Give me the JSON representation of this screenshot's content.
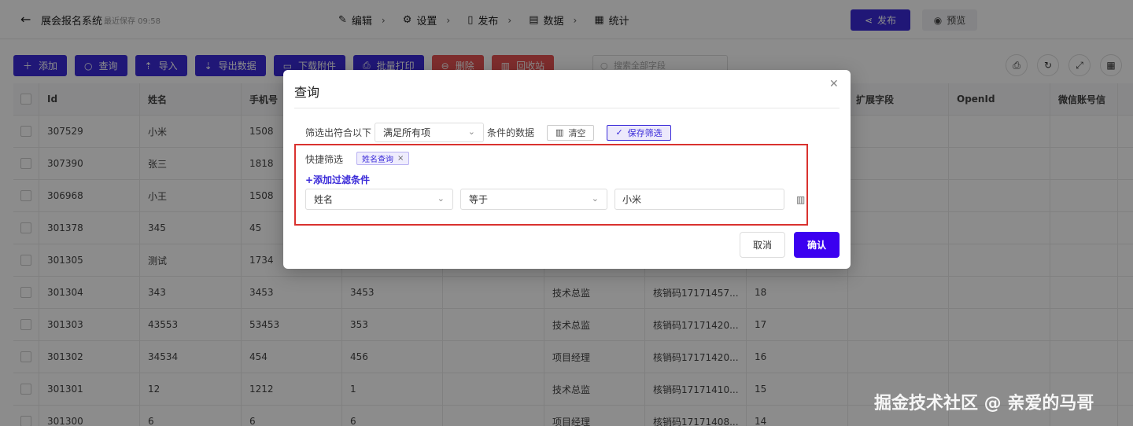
{
  "topbar": {
    "back_icon": "arrow-left-icon",
    "app_title": "展会报名系统",
    "save_status": "最近保存 09:58",
    "nav": [
      {
        "label": "编辑",
        "icon": "edit-icon"
      },
      {
        "label": "设置",
        "icon": "gear-icon"
      },
      {
        "label": "发布",
        "icon": "publish-doc-icon"
      },
      {
        "label": "数据",
        "icon": "data-doc-icon"
      },
      {
        "label": "统计",
        "icon": "stats-icon"
      }
    ],
    "publish_label": "发布",
    "preview_label": "预览"
  },
  "toolbar": {
    "buttons": [
      {
        "label": "添加",
        "icon": "plus-icon"
      },
      {
        "label": "查询",
        "icon": "search-icon"
      },
      {
        "label": "导入",
        "icon": "upload-icon"
      },
      {
        "label": "导出数据",
        "icon": "download-icon"
      },
      {
        "label": "下载附件",
        "icon": "folder-icon"
      },
      {
        "label": "批量打印",
        "icon": "print-icon"
      },
      {
        "label": "删除",
        "icon": "minus-circle-icon"
      },
      {
        "label": "回收站",
        "icon": "trash-icon"
      }
    ],
    "search_placeholder": "搜索全部字段",
    "round_tools": [
      "print-icon",
      "refresh-icon",
      "fullscreen-icon",
      "layout-icon"
    ]
  },
  "table": {
    "columns": [
      "",
      "Id",
      "姓名",
      "手机号",
      "",
      "",
      "",
      "",
      "",
      "扩展字段",
      "OpenId",
      "微信账号信"
    ],
    "rows": [
      [
        "307529",
        "小米",
        "1508",
        "",
        "",
        "",
        "",
        ""
      ],
      [
        "307390",
        "张三",
        "1818",
        "",
        "",
        "",
        "",
        ""
      ],
      [
        "306968",
        "小王",
        "1508",
        "",
        "",
        "",
        "",
        ""
      ],
      [
        "301378",
        "345",
        "45",
        "",
        "",
        "",
        "",
        ""
      ],
      [
        "301305",
        "测试",
        "1734",
        "",
        "",
        "",
        "",
        ""
      ],
      [
        "301304",
        "343",
        "3453",
        "3453",
        "",
        "技术总监",
        "核销码17171457...",
        "18"
      ],
      [
        "301303",
        "43553",
        "53453",
        "353",
        "",
        "技术总监",
        "核销码17171420...",
        "17"
      ],
      [
        "301302",
        "34534",
        "454",
        "456",
        "",
        "项目经理",
        "核销码17171420...",
        "16"
      ],
      [
        "301301",
        "12",
        "1212",
        "1",
        "",
        "技术总监",
        "核销码17171410...",
        "15"
      ],
      [
        "301300",
        "6",
        "6",
        "6",
        "",
        "项目经理",
        "核销码17171408...",
        "14"
      ]
    ]
  },
  "modal": {
    "title": "查询",
    "filter_prefix": "筛选出符合以下",
    "match_mode": "满足所有项",
    "filter_suffix": "条件的数据",
    "clear_label": "清空",
    "save_filter_label": "保存筛选",
    "quick_filter_label": "快捷筛选",
    "quick_chip": "姓名查询",
    "add_condition": "+添加过滤条件",
    "condition": {
      "field": "姓名",
      "operator": "等于",
      "value": "小米"
    },
    "cancel_label": "取消",
    "confirm_label": "确认"
  },
  "watermark": "掘金技术社区 @ 亲爱的马哥",
  "colors": {
    "primary": "#3b2bd9",
    "danger": "#e55353",
    "highlight_box": "#d9322f"
  }
}
